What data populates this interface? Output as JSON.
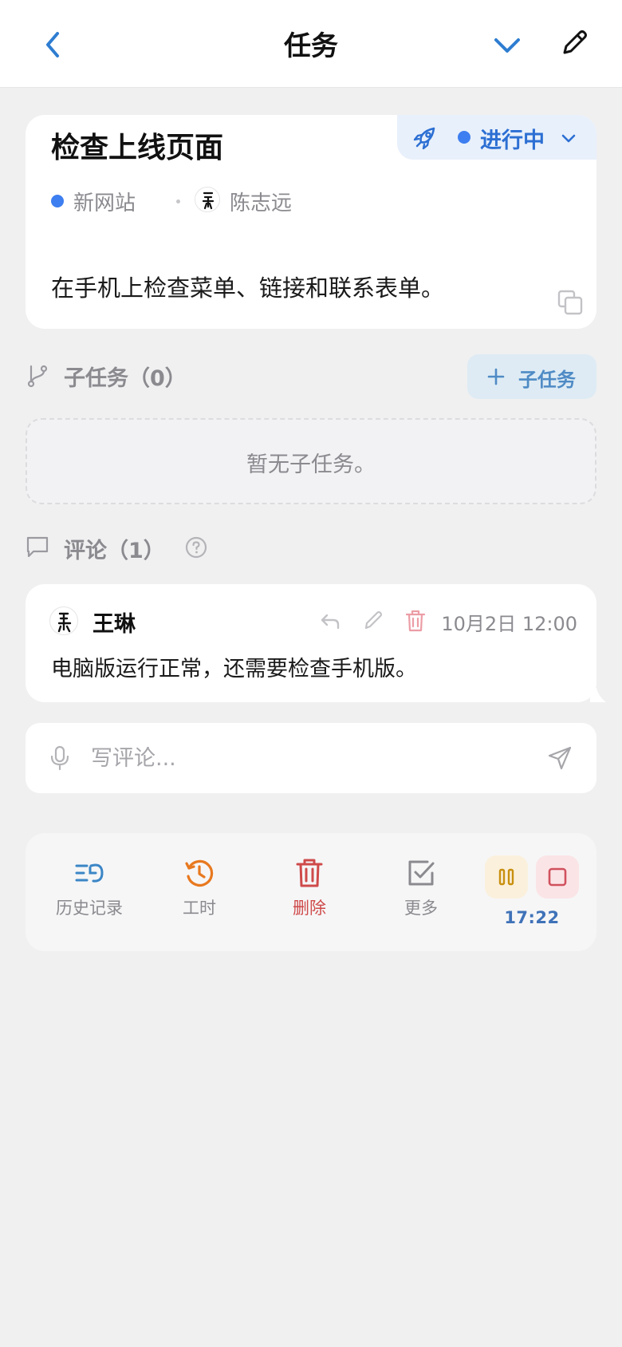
{
  "header": {
    "title": "任务",
    "back_icon": "chevron-left-icon",
    "collapse_icon": "chevron-down-icon",
    "edit_icon": "pencil-icon"
  },
  "task": {
    "title": "检查上线页面",
    "status": {
      "label": "进行中",
      "icon": "rocket-icon",
      "color": "#3d7ef0"
    },
    "project": {
      "name": "新网站",
      "color": "#3d7ef0"
    },
    "assignee": "陈志远",
    "description": "在手机上检查菜单、链接和联系表单。"
  },
  "subtasks": {
    "title": "子任务（0）",
    "add_label": "子任务",
    "empty_text": "暂无子任务。"
  },
  "comments": {
    "title": "评论（1）",
    "items": [
      {
        "author": "王琳",
        "time": "10月2日 12:00",
        "body": "电脑版运行正常，还需要检查手机版。"
      }
    ],
    "input_placeholder": "写评论..."
  },
  "toolbar": {
    "history_label": "历史记录",
    "worklog_label": "工时",
    "delete_label": "删除",
    "more_label": "更多",
    "timer": "17:22"
  },
  "colors": {
    "accent": "#2c6fd3",
    "history": "#3b86c6",
    "worklog": "#e8791f",
    "delete": "#cf4a4a",
    "timer_pause": "#c9900f",
    "timer_stop": "#d0515e"
  }
}
